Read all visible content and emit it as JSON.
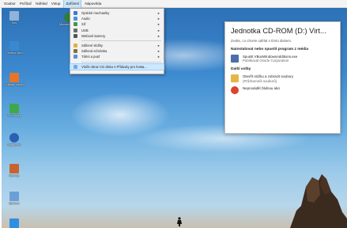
{
  "menubar": {
    "items": [
      "Soubor",
      "Počítač",
      "Náhled",
      "Vstup",
      "Zařízení",
      "Nápověda"
    ],
    "active_index": 4
  },
  "devices_menu": {
    "items": [
      {
        "label": "Optické mechaniky",
        "icon": "optical-drive-icon",
        "submenu": true,
        "color": "#3a7bd5"
      },
      {
        "label": "Audio",
        "icon": "audio-icon",
        "submenu": true,
        "color": "#4d8fd6"
      },
      {
        "label": "Síť",
        "icon": "network-icon",
        "submenu": true,
        "color": "#3b9a4a"
      },
      {
        "label": "USB",
        "icon": "usb-icon",
        "submenu": true,
        "color": "#6c6c6c"
      },
      {
        "label": "Webové kamery",
        "icon": "webcam-icon",
        "submenu": true,
        "color": "#555555"
      },
      {
        "label": "Sdílené složky",
        "icon": "shared-folder-icon",
        "submenu": true,
        "color": "#e0b040"
      },
      {
        "label": "Sdílená schránka",
        "icon": "clipboard-icon",
        "submenu": true,
        "color": "#8a6d3b"
      },
      {
        "label": "Táhni a pusť",
        "icon": "drag-drop-icon",
        "submenu": true,
        "color": "#5a8fd0"
      },
      {
        "label": "Vložit obraz CD disku s Přídavky pro hosta...",
        "icon": "cd-image-icon",
        "submenu": false,
        "color": "#7aa7e0",
        "selected": true
      }
    ]
  },
  "autoplay": {
    "title": "Jednotka CD-ROM (D:) Virt...",
    "subtitle": "Zvolte, co chcete udělat s tímto diskem.",
    "section1": "Nainstalovat nebo spustit program z média",
    "option1_label": "Spustit VBoxWindowsAdditions.exe",
    "option1_sub": "Publikoval Oracle Corporation",
    "section2": "Další volby",
    "option2_label": "Otevřít složku a zobrazit soubory",
    "option2_sub": "(Průzkumník souborů)",
    "option3_label": "Neprovádět žádnou akci"
  },
  "desktop_icons": [
    {
      "label": "Koš",
      "icon": "recycle-bin-icon",
      "color": "#8fb3d9"
    },
    {
      "label": "Microsoft Edge",
      "icon": "edge-icon",
      "color": "#2f7d3a"
    },
    {
      "label": "Centrum akcí",
      "icon": "action-center-icon",
      "color": "#3a88d0"
    },
    {
      "label": "Ovládací panely",
      "icon": "control-panel-icon",
      "color": "#e8742a"
    },
    {
      "label": "Poznámky",
      "icon": "notes-icon",
      "color": "#3fa84a"
    },
    {
      "label": "Nastavení",
      "icon": "settings-icon",
      "color": "#2d5fb3"
    },
    {
      "label": "Nástroje",
      "icon": "tools-icon",
      "color": "#c8632e"
    },
    {
      "label": "Správce",
      "icon": "manager-icon",
      "color": "#6a9fd8"
    },
    {
      "label": "Aplikace",
      "icon": "app-icon",
      "color": "#2e8fe0"
    }
  ]
}
